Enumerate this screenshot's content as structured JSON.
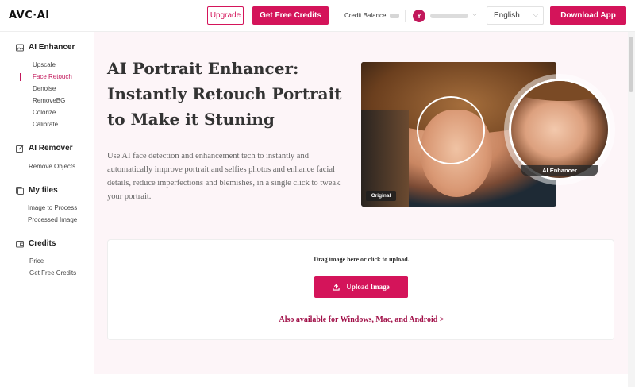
{
  "header": {
    "logo": "AVC·AI",
    "upgrade_label": "Upgrade",
    "free_credits_label": "Get Free Credits",
    "credit_balance_label": "Credit Balance:",
    "avatar_letter": "Y",
    "language": "English",
    "download_label": "Download App"
  },
  "sidebar": {
    "sections": [
      {
        "title": "AI Enhancer",
        "icon": "image-icon",
        "items": [
          "Upscale",
          "Face Retouch",
          "Denoise",
          "RemoveBG",
          "Colorize",
          "Calibrate"
        ]
      },
      {
        "title": "AI Remover",
        "icon": "edit-icon",
        "items": [
          "Remove Objects"
        ]
      },
      {
        "title": "My files",
        "icon": "files-icon",
        "items": [
          "Image to Process",
          "Processed Image"
        ]
      },
      {
        "title": "Credits",
        "icon": "wallet-icon",
        "items": [
          "Price",
          "Get Free Credits"
        ]
      }
    ],
    "active_item": "Face Retouch"
  },
  "main": {
    "title": "AI Portrait Enhancer: Instantly Retouch Portrait to Make it Stuning",
    "description": "Use AI face detection and enhancement tech to instantly and automatically improve portrait and selfies photos and enhance facial details, reduce imperfections and blemishes, in a single click to tweak your portrait.",
    "badge_original": "Original",
    "badge_enhanced": "AI Enhancer"
  },
  "upload": {
    "drag_text": "Drag image here or click to upload.",
    "button_label": "Upload Image",
    "also_available": "Also available for Windows, Mac, and Android >"
  },
  "colors": {
    "accent": "#d4145a",
    "main_bg": "#fdf5f8"
  }
}
